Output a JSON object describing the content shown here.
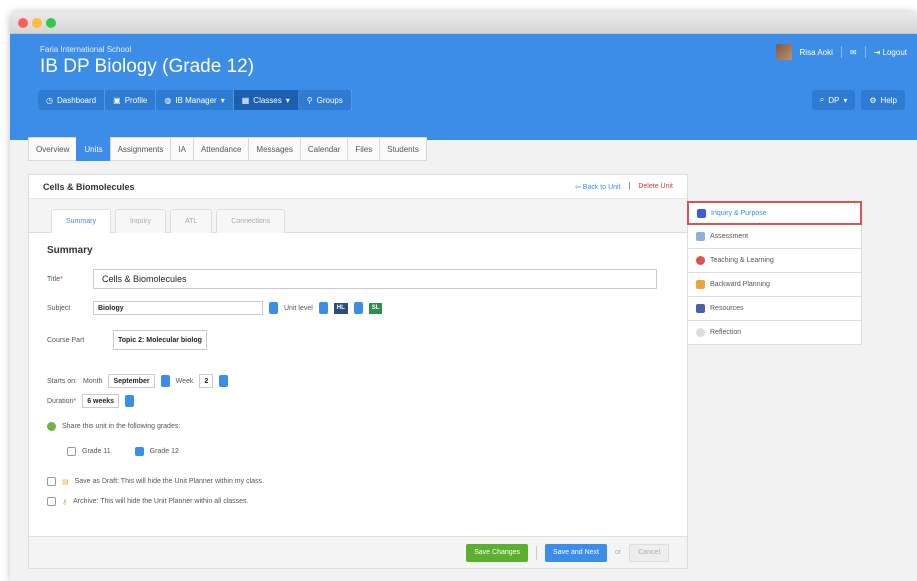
{
  "header": {
    "school": "Faria International School",
    "title": "IB DP Biology (Grade 12)",
    "user_name": "Risa Aoki",
    "logout_label": "Logout"
  },
  "nav": {
    "items": [
      {
        "label": "Dashboard",
        "icon": "clock-icon"
      },
      {
        "label": "Profile",
        "icon": "id-card-icon"
      },
      {
        "label": "IB Manager",
        "icon": "globe-icon"
      },
      {
        "label": "Classes",
        "icon": "grid-icon"
      },
      {
        "label": "Groups",
        "icon": "pin-icon"
      }
    ],
    "right": [
      {
        "label": "DP",
        "icon": "search-icon"
      },
      {
        "label": "Help",
        "icon": "gear-icon"
      }
    ]
  },
  "tabs": [
    "Overview",
    "Units",
    "Assignments",
    "IA",
    "Attendance",
    "Messages",
    "Calendar",
    "Files",
    "Students"
  ],
  "unit": {
    "heading": "Cells & Biomolecules",
    "back_link": "Back to Unit",
    "delete_link": "Delete Unit"
  },
  "subtabs": [
    "Summary",
    "Inquiry",
    "ATL",
    "Connections"
  ],
  "form": {
    "section_title": "Summary",
    "title_label": "Title",
    "title_value": "Cells & Biomolecules",
    "subject_label": "Subject",
    "subject_value": "Biology",
    "unit_level_label": "Unit level",
    "level_hl": "HL",
    "level_sl": "SL",
    "course_part_label": "Course Part",
    "course_part_value": "Topic 2: Molecular biolog",
    "starts_on_label": "Starts on:",
    "month_label": "Month",
    "month_value": "September",
    "week_label": "Week",
    "week_value": "2",
    "duration_label": "Duration",
    "duration_value": "6 weeks",
    "share_label": "Share this unit in the following grades:",
    "grade11": "Grade 11",
    "grade12": "Grade 12",
    "draft_label": "Save as Draft: This will hide the Unit Planner within my class.",
    "archive_label": "Archive: This will hide the Unit Planner within all classes."
  },
  "footer": {
    "save_changes": "Save Changes",
    "save_next": "Save and Next",
    "or": "or",
    "cancel": "Cancel"
  },
  "sidebar": {
    "items": [
      {
        "label": "Inquiry & Purpose",
        "icon": "shapes-icon",
        "color": "#3b5ed8"
      },
      {
        "label": "Assessment",
        "icon": "document-icon",
        "color": "#8fb0d8"
      },
      {
        "label": "Teaching & Learning",
        "icon": "apple-icon",
        "color": "#d9534f"
      },
      {
        "label": "Backward Planning",
        "icon": "puzzle-icon",
        "color": "#e8a640"
      },
      {
        "label": "Resources",
        "icon": "books-icon",
        "color": "#4a5fa8"
      },
      {
        "label": "Reflection",
        "icon": "magnifier-icon",
        "color": "#bbbbbb"
      }
    ]
  },
  "colors": {
    "brand": "#3b8de8",
    "save_green": "#5cb030",
    "highlight": "#d9534f"
  }
}
